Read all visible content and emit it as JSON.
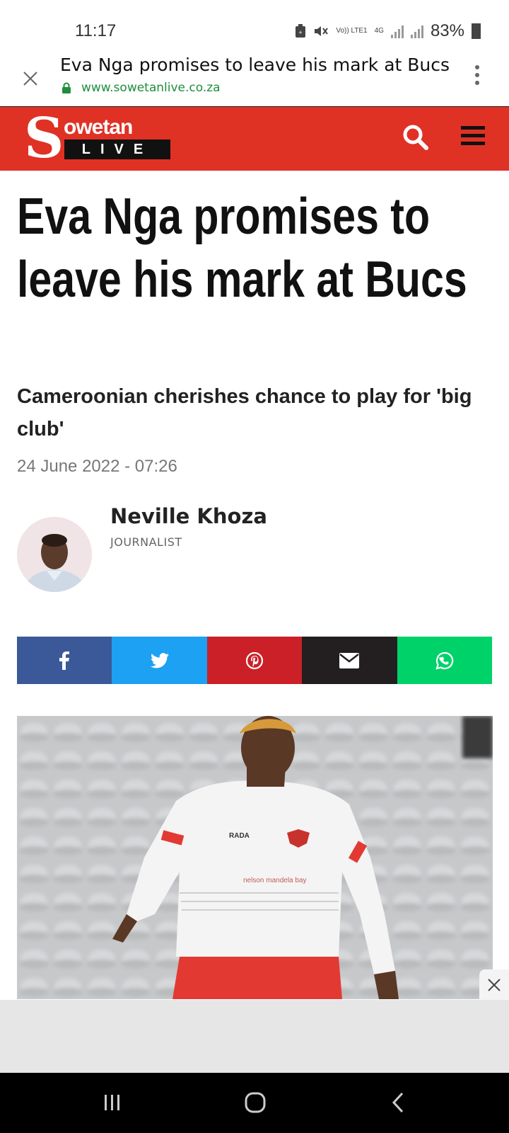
{
  "status_bar": {
    "time": "11:17",
    "network_label_1": "Vo)) LTE1",
    "network_label_2": "4G",
    "battery": "83%"
  },
  "tab": {
    "title": "Eva Nga promises to leave his mark at Bucs",
    "url": "www.sowetanlive.co.za"
  },
  "site": {
    "logo_letter": "S",
    "logo_word": "owetan",
    "logo_live": "LIVE",
    "brand_color": "#e03125"
  },
  "article": {
    "headline": "Eva Nga promises to leave his mark at Bucs",
    "subheadline": "Cameroonian cherishes chance to play for 'big club'",
    "date": "24 June 2022 - 07:26",
    "author_name": "Neville Khoza",
    "author_role": "JOURNALIST"
  },
  "share": [
    {
      "name": "facebook-icon",
      "color": "#3b5998"
    },
    {
      "name": "twitter-icon",
      "color": "#1da1f2"
    },
    {
      "name": "pinterest-icon",
      "color": "#cb2027"
    },
    {
      "name": "email-icon",
      "color": "#231f20"
    },
    {
      "name": "whatsapp-icon",
      "color": "#00d26a"
    }
  ],
  "image": {
    "jersey_text": "RADA",
    "sponsor_text": "nelson mandela bay"
  }
}
